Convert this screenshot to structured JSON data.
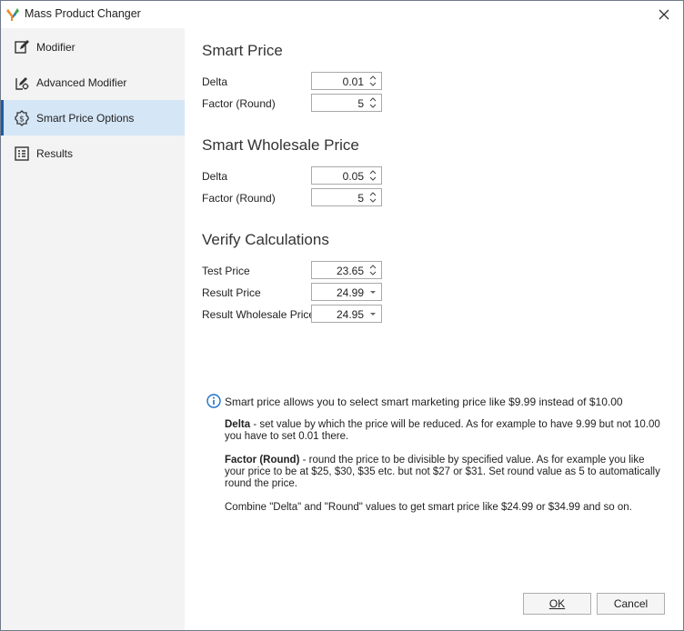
{
  "window": {
    "title": "Mass Product Changer"
  },
  "sidebar": {
    "items": [
      {
        "label": "Modifier",
        "icon": "edit-icon"
      },
      {
        "label": "Advanced Modifier",
        "icon": "advanced-edit-icon"
      },
      {
        "label": "Smart Price Options",
        "icon": "dollar-gear-icon"
      },
      {
        "label": "Results",
        "icon": "results-table-icon"
      }
    ],
    "active_index": 2
  },
  "smart_price": {
    "title": "Smart Price",
    "delta_label": "Delta",
    "delta_value": "0.01",
    "factor_label": "Factor (Round)",
    "factor_value": "5"
  },
  "smart_wholesale": {
    "title": "Smart Wholesale Price",
    "delta_label": "Delta",
    "delta_value": "0.05",
    "factor_label": "Factor (Round)",
    "factor_value": "5"
  },
  "verify": {
    "title": "Verify Calculations",
    "test_price_label": "Test Price",
    "test_price_value": "23.65",
    "result_price_label": "Result Price",
    "result_price_value": "24.99",
    "result_wholesale_label": "Result Wholesale Price",
    "result_wholesale_value": "24.95"
  },
  "info": {
    "main": "Smart price allows you to select smart marketing price like $9.99 instead of $10.00",
    "delta_term": "Delta",
    "delta_text": " - set value by which the price will be reduced. As for example to have 9.99 but not 10.00 you have to set 0.01 there.",
    "factor_term": "Factor (Round)",
    "factor_text": " - round the price to be divisible by specified value. As for example you like your price to be at $25, $30, $35 etc. but not $27 or $31. Set round value as 5 to automatically round the price.",
    "combine_text": "Combine \"Delta\" and \"Round\" values to get smart price like $24.99 or $34.99 and so on."
  },
  "buttons": {
    "ok": "OK",
    "cancel": "Cancel"
  }
}
